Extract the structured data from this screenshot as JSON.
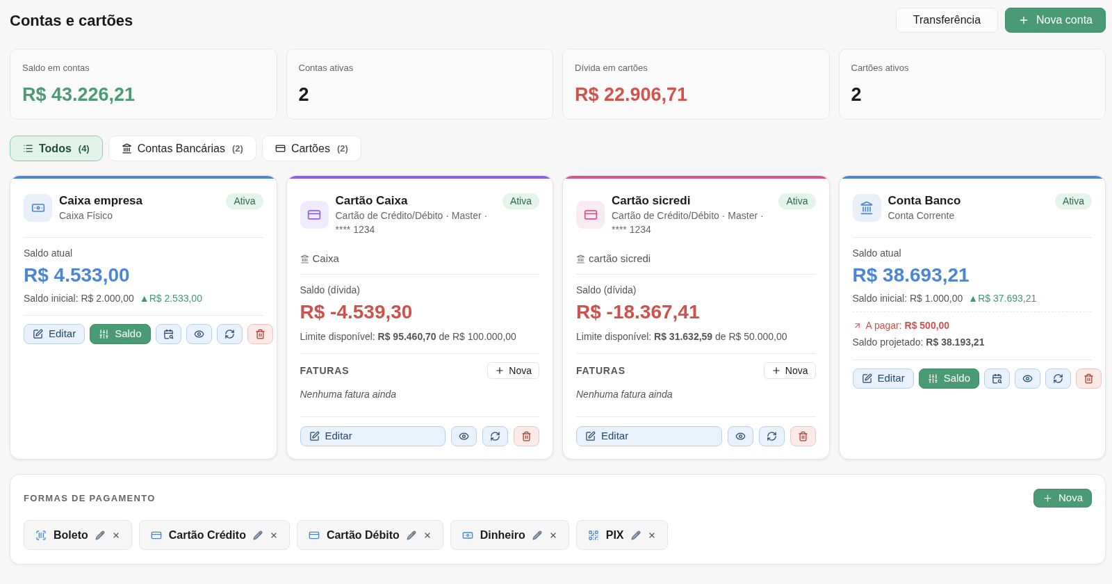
{
  "header": {
    "title": "Contas e cartões",
    "transfer_button": {
      "label": "Transferência"
    },
    "new_button": {
      "label": "Nova conta"
    }
  },
  "stats": [
    {
      "label": "Saldo em contas",
      "value": "R$ 43.226,21",
      "color": "#4c9a78"
    },
    {
      "label": "Contas ativas",
      "value": "2",
      "color": "#1a1a1a"
    },
    {
      "label": "Dívida em cartões",
      "value": "R$ 22.906,71",
      "color": "#d0534c"
    },
    {
      "label": "Cartões ativos",
      "value": "2",
      "color": "#1a1a1a"
    }
  ],
  "tabs": [
    {
      "kind": "all",
      "label": "Todos",
      "count": "(4)",
      "selected": true
    },
    {
      "kind": "bank",
      "label": "Contas Bancárias",
      "count": "(2)",
      "selected": false
    },
    {
      "kind": "card",
      "label": "Cartões",
      "count": "(2)",
      "selected": false
    }
  ],
  "accounts": [
    {
      "kind": "cash",
      "color": "#4a86d4",
      "name": "Caixa empresa",
      "subtitle": "Caixa Físico",
      "status": "Ativa",
      "balance_label": "Saldo atual",
      "balance": "R$ 4.533,00",
      "initial": "Saldo inicial: R$ 2.000,00",
      "change": "▲R$ 2.533,00",
      "actions": [
        {
          "kind": "edit",
          "label": "Editar"
        },
        {
          "kind": "adjust",
          "label": "Saldo"
        },
        {
          "kind": "calendar"
        },
        {
          "kind": "view"
        },
        {
          "kind": "refresh"
        },
        {
          "kind": "delete"
        }
      ]
    },
    {
      "kind": "card",
      "color": "#8b5cf6",
      "name": "Cartão Caixa",
      "subtitle": "Cartão de Crédito/Débito · Master · **** 1234",
      "status": "Ativa",
      "bank": "Caixa",
      "balance_label": "Saldo (dívida)",
      "balance": "R$ -4.539,30",
      "limit": "Limite disponível: **R$ 95.460,70** de R$ 100.000,00",
      "invoices": {
        "title": "FATURAS",
        "new_label": "Nova",
        "empty": "Nenhuma fatura ainda"
      },
      "actions": [
        {
          "kind": "edit",
          "label": "Editar"
        },
        {
          "kind": "view"
        },
        {
          "kind": "refresh"
        },
        {
          "kind": "delete"
        }
      ]
    },
    {
      "kind": "card",
      "color": "#d9518d",
      "name": "Cartão sicredi",
      "subtitle": "Cartão de Crédito/Débito · Master · **** 1234",
      "status": "Ativa",
      "bank": "cartão sicredi",
      "balance_label": "Saldo (dívida)",
      "balance": "R$ -18.367,41",
      "limit": "Limite disponível: **R$ 31.632,59** de R$ 50.000,00",
      "invoices": {
        "title": "FATURAS",
        "new_label": "Nova",
        "empty": "Nenhuma fatura ainda"
      },
      "actions": [
        {
          "kind": "edit",
          "label": "Editar"
        },
        {
          "kind": "view"
        },
        {
          "kind": "refresh"
        },
        {
          "kind": "delete"
        }
      ]
    },
    {
      "kind": "bank",
      "color": "#4a86d4",
      "name": "Conta Banco",
      "subtitle": "Conta Corrente",
      "status": "Ativa",
      "balance_label": "Saldo atual",
      "balance": "R$ 38.693,21",
      "initial": "Saldo inicial: R$ 1.000,00",
      "change": "▲R$ 37.693,21",
      "pending": "A pagar: **R$ 500,00**",
      "projected": "Saldo projetado: **R$ 38.193,21**",
      "actions": [
        {
          "kind": "edit",
          "label": "Editar"
        },
        {
          "kind": "adjust",
          "label": "Saldo"
        },
        {
          "kind": "calendar"
        },
        {
          "kind": "view"
        },
        {
          "kind": "refresh"
        },
        {
          "kind": "delete"
        }
      ]
    }
  ],
  "payment_methods": {
    "title": "FORMAS DE PAGAMENTO",
    "new_button": {
      "label": "Nova"
    },
    "items": [
      {
        "kind": "barcode",
        "label": "Boleto"
      },
      {
        "kind": "card",
        "label": "Cartão Crédito"
      },
      {
        "kind": "card",
        "label": "Cartão Débito"
      },
      {
        "kind": "cash",
        "label": "Dinheiro"
      },
      {
        "kind": "qr",
        "label": "PIX"
      }
    ]
  }
}
